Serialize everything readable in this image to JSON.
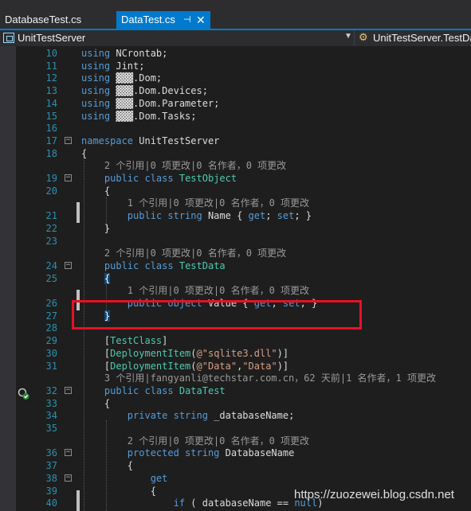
{
  "tabs": [
    {
      "label": "DatabaseTest.cs",
      "active": false
    },
    {
      "label": "DataTest.cs",
      "active": true,
      "pin_icon": "pin-icon",
      "close_icon": "close-icon"
    }
  ],
  "navbar": {
    "project": "UnitTestServer",
    "member": "UnitTestServer.TestDa"
  },
  "lines": [
    {
      "n": "10",
      "parts": [
        [
          "kw",
          "using"
        ],
        [
          "pl",
          " NCrontab;"
        ]
      ]
    },
    {
      "n": "11",
      "parts": [
        [
          "kw",
          "using"
        ],
        [
          "pl",
          " Jint;"
        ]
      ]
    },
    {
      "n": "12",
      "parts": [
        [
          "kw",
          "using"
        ],
        [
          "pl",
          " ▓▓▓.Dom;"
        ]
      ]
    },
    {
      "n": "13",
      "parts": [
        [
          "kw",
          "using"
        ],
        [
          "pl",
          " ▓▓▓.Dom.Devices;"
        ]
      ]
    },
    {
      "n": "14",
      "parts": [
        [
          "kw",
          "using"
        ],
        [
          "pl",
          " ▓▓▓.Dom.Parameter;"
        ]
      ]
    },
    {
      "n": "15",
      "parts": [
        [
          "kw",
          "using"
        ],
        [
          "pl",
          " ▓▓▓.Dom.Tasks;"
        ]
      ]
    },
    {
      "n": "16",
      "parts": []
    },
    {
      "n": "17",
      "parts": [
        [
          "kw",
          "namespace"
        ],
        [
          "pl",
          " UnitTestServer"
        ]
      ]
    },
    {
      "n": "18",
      "parts": [
        [
          "pl",
          "{"
        ]
      ]
    },
    {
      "n": "",
      "lens": "    2 个引用|0 项更改|0 名作者，0 项更改"
    },
    {
      "n": "19",
      "parts": [
        [
          "pl",
          "    "
        ],
        [
          "kw",
          "public class"
        ],
        [
          "pl",
          " "
        ],
        [
          "ty",
          "TestObject"
        ]
      ]
    },
    {
      "n": "20",
      "parts": [
        [
          "pl",
          "    {"
        ]
      ]
    },
    {
      "n": "",
      "lens": "        1 个引用|0 项更改|0 名作者，0 项更改"
    },
    {
      "n": "21",
      "parts": [
        [
          "pl",
          "        "
        ],
        [
          "kw",
          "public string"
        ],
        [
          "pl",
          " Name { "
        ],
        [
          "kw",
          "get"
        ],
        [
          "pl",
          "; "
        ],
        [
          "kw",
          "set"
        ],
        [
          "pl",
          "; }"
        ]
      ]
    },
    {
      "n": "22",
      "parts": [
        [
          "pl",
          "    }"
        ]
      ]
    },
    {
      "n": "23",
      "parts": []
    },
    {
      "n": "",
      "lens": "    2 个引用|0 项更改|0 名作者，0 项更改"
    },
    {
      "n": "24",
      "parts": [
        [
          "pl",
          "    "
        ],
        [
          "kw",
          "public class"
        ],
        [
          "pl",
          " "
        ],
        [
          "ty",
          "TestData"
        ]
      ]
    },
    {
      "n": "25",
      "parts": [
        [
          "pl",
          "    "
        ],
        [
          "hl",
          "{"
        ]
      ]
    },
    {
      "n": "",
      "lens": "        1 个引用|0 项更改|0 名作者，0 项更改"
    },
    {
      "n": "26",
      "parts": [
        [
          "pl",
          "        "
        ],
        [
          "kw",
          "public object"
        ],
        [
          "pl",
          " Value { "
        ],
        [
          "kw",
          "get"
        ],
        [
          "pl",
          "; "
        ],
        [
          "kw",
          "set"
        ],
        [
          "pl",
          "; }"
        ]
      ]
    },
    {
      "n": "27",
      "parts": [
        [
          "pl",
          "    "
        ],
        [
          "hl",
          "}"
        ]
      ]
    },
    {
      "n": "28",
      "parts": []
    },
    {
      "n": "29",
      "parts": [
        [
          "pl",
          "    ["
        ],
        [
          "ty",
          "TestClass"
        ],
        [
          "pl",
          "]"
        ]
      ]
    },
    {
      "n": "30",
      "parts": [
        [
          "pl",
          "    ["
        ],
        [
          "ty",
          "DeploymentItem"
        ],
        [
          "pl",
          "("
        ],
        [
          "st",
          "@\"sqlite3.dll\""
        ],
        [
          "pl",
          ")]"
        ]
      ]
    },
    {
      "n": "31",
      "parts": [
        [
          "pl",
          "    ["
        ],
        [
          "ty",
          "DeploymentItem"
        ],
        [
          "pl",
          "("
        ],
        [
          "st",
          "@\"Data\""
        ],
        [
          "pl",
          ","
        ],
        [
          "st",
          "\"Data\""
        ],
        [
          "pl",
          ")]"
        ]
      ]
    },
    {
      "n": "",
      "lens": "    3 个引用|fangyanli@techstar.com.cn，62 天前|1 名作者，1 项更改"
    },
    {
      "n": "32",
      "parts": [
        [
          "pl",
          "    "
        ],
        [
          "kw",
          "public class"
        ],
        [
          "pl",
          " "
        ],
        [
          "ty",
          "DataTest"
        ]
      ]
    },
    {
      "n": "33",
      "parts": [
        [
          "pl",
          "    {"
        ]
      ]
    },
    {
      "n": "34",
      "parts": [
        [
          "pl",
          "        "
        ],
        [
          "kw",
          "private string"
        ],
        [
          "pl",
          " _databaseName;"
        ]
      ]
    },
    {
      "n": "35",
      "parts": []
    },
    {
      "n": "",
      "lens": "        2 个引用|0 项更改|0 名作者，0 项更改"
    },
    {
      "n": "36",
      "parts": [
        [
          "pl",
          "        "
        ],
        [
          "kw",
          "protected string"
        ],
        [
          "pl",
          " DatabaseName"
        ]
      ]
    },
    {
      "n": "37",
      "parts": [
        [
          "pl",
          "        {"
        ]
      ]
    },
    {
      "n": "38",
      "parts": [
        [
          "pl",
          "            "
        ],
        [
          "kw",
          "get"
        ]
      ]
    },
    {
      "n": "39",
      "parts": [
        [
          "pl",
          "            {"
        ]
      ]
    },
    {
      "n": "40",
      "parts": [
        [
          "pl",
          "                "
        ],
        [
          "kw",
          "if"
        ],
        [
          "pl",
          " ( databaseName == "
        ],
        [
          "kw",
          "null"
        ],
        [
          "pl",
          ")"
        ]
      ]
    }
  ],
  "watermark": "https://zuozewei.blog.csdn.net"
}
